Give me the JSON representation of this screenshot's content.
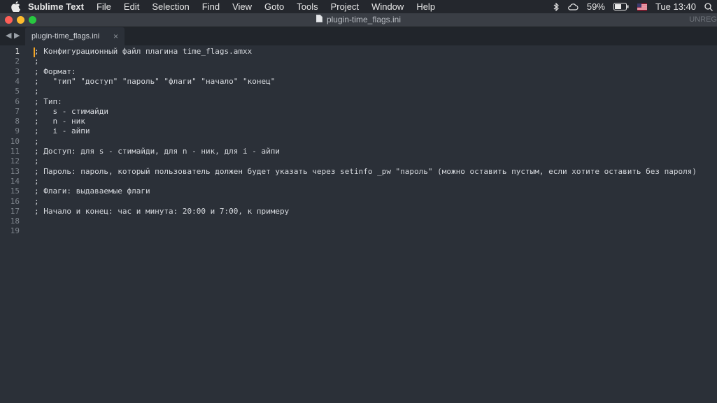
{
  "menubar": {
    "app_name": "Sublime Text",
    "items": [
      "File",
      "Edit",
      "Selection",
      "Find",
      "View",
      "Goto",
      "Tools",
      "Project",
      "Window",
      "Help"
    ],
    "battery": "59%",
    "clock": "Tue 13:40"
  },
  "window": {
    "title": "plugin-time_flags.ini",
    "unregistered": "UNREG"
  },
  "tab": {
    "label": "plugin-time_flags.ini",
    "close": "×"
  },
  "editor": {
    "current_line": 1,
    "lines": [
      "; Конфигурационный файл плагина time_flags.amxx",
      ";",
      "; Формат:",
      ";   \"тип\" \"доступ\" \"пароль\" \"флаги\" \"начало\" \"конец\"",
      ";",
      "; Тип:",
      ";   s - стимайди",
      ";   n - ник",
      ";   i - айпи",
      ";",
      "; Доступ: для s - стимайди, для n - ник, для i - айпи",
      ";",
      "; Пароль: пароль, который пользователь должен будет указать через setinfo _pw \"пароль\" (можно оставить пустым, если хотите оставить без пароля)",
      ";",
      "; Флаги: выдаваемые флаги",
      ";",
      "; Начало и конец: час и минута: 20:00 и 7:00, к примеру",
      "",
      ""
    ]
  },
  "colors": {
    "close": "#fe5f57",
    "minimize": "#febc2e",
    "zoom": "#28c840",
    "cursor": "#f6a623"
  }
}
